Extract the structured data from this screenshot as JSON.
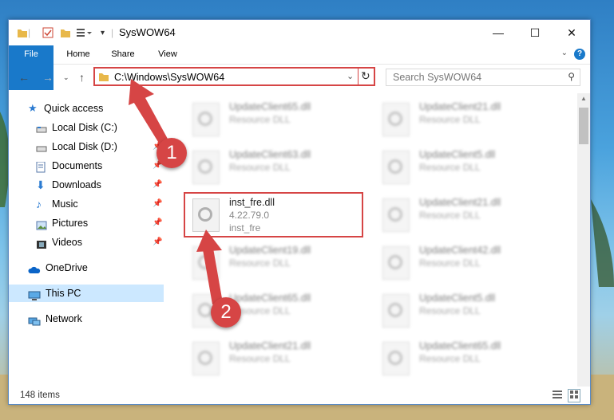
{
  "window": {
    "title": "SysWOW64",
    "controls": {
      "minimize": "—",
      "maximize": "☐",
      "close": "✕"
    }
  },
  "ribbon": {
    "tabs": [
      "File",
      "Home",
      "Share",
      "View"
    ],
    "help": "?"
  },
  "address_bar": {
    "path": "C:\\Windows\\SysWOW64",
    "search_placeholder": "Search SysWOW64"
  },
  "nav_pane": {
    "items": [
      {
        "label": "Quick access",
        "icon": "star-icon",
        "pinned": false
      },
      {
        "label": "Local Disk (C:)",
        "icon": "drive-icon",
        "pinned": false
      },
      {
        "label": "Local Disk (D:)",
        "icon": "drive-icon",
        "pinned": true
      },
      {
        "label": "Documents",
        "icon": "document-icon",
        "pinned": true
      },
      {
        "label": "Downloads",
        "icon": "download-icon",
        "pinned": true
      },
      {
        "label": "Music",
        "icon": "music-icon",
        "pinned": true
      },
      {
        "label": "Pictures",
        "icon": "pictures-icon",
        "pinned": true
      },
      {
        "label": "Videos",
        "icon": "video-icon",
        "pinned": true
      },
      {
        "label": "OneDrive",
        "icon": "cloud-icon",
        "pinned": false
      },
      {
        "label": "This PC",
        "icon": "pc-icon",
        "pinned": false,
        "selected": true
      },
      {
        "label": "Network",
        "icon": "network-icon",
        "pinned": false
      }
    ]
  },
  "files": [
    {
      "name": "UpdateClient65.dll",
      "desc": "Resource DLL",
      "blurred": true
    },
    {
      "name": "UpdateClient21.dll",
      "desc": "Resource DLL",
      "blurred": true
    },
    {
      "name": "UpdateClient63.dll",
      "desc": "Resource DLL",
      "blurred": true
    },
    {
      "name": "UpdateClient5.dll",
      "desc": "Resource DLL",
      "blurred": true
    },
    {
      "name": "inst_fre.dll",
      "desc": "4.22.79.0",
      "desc2": "inst_fre",
      "blurred": false
    },
    {
      "name": "UpdateClient21.dll",
      "desc": "Resource DLL",
      "blurred": true
    },
    {
      "name": "UpdateClient19.dll",
      "desc": "Resource DLL",
      "blurred": true
    },
    {
      "name": "UpdateClient42.dll",
      "desc": "Resource DLL",
      "blurred": true
    },
    {
      "name": "UpdateClient65.dll",
      "desc": "Resource DLL",
      "blurred": true
    },
    {
      "name": "UpdateClient5.dll",
      "desc": "Resource DLL",
      "blurred": true
    },
    {
      "name": "UpdateClient21.dll",
      "desc": "Resource DLL",
      "blurred": true
    },
    {
      "name": "UpdateClient65.dll",
      "desc": "Resource DLL",
      "blurred": true
    }
  ],
  "status": {
    "item_count": "148 items"
  },
  "callouts": [
    "1",
    "2"
  ],
  "colors": {
    "accent": "#1979ca",
    "highlight": "#d64545",
    "selected": "#cce8ff"
  }
}
